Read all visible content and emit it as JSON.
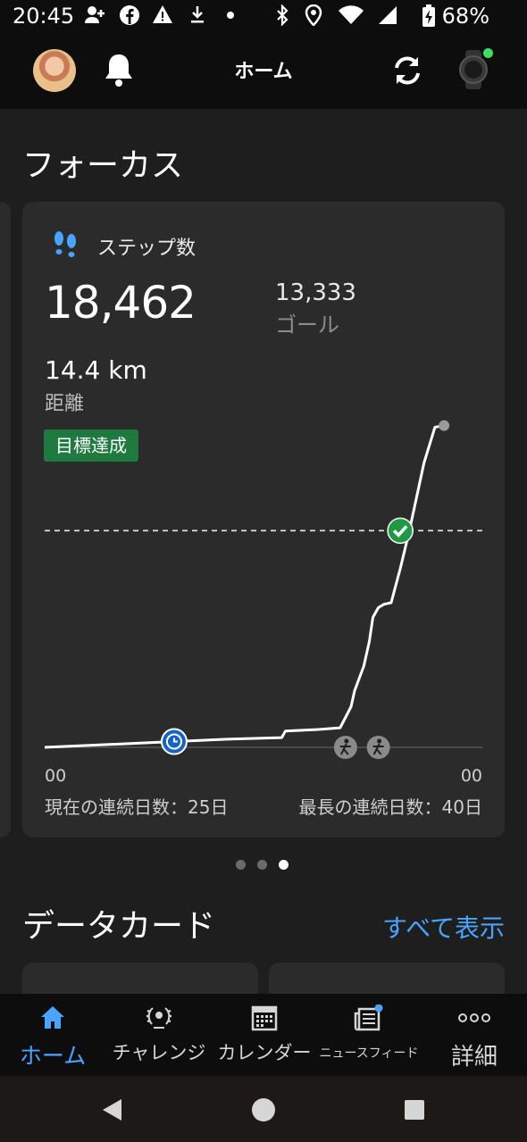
{
  "status_bar": {
    "time": "20:45",
    "battery": "68%",
    "icons": [
      "add-person-icon",
      "facebook-icon",
      "warning-icon",
      "download-icon",
      "dot-icon",
      "bluetooth-icon",
      "location-icon",
      "wifi-icon",
      "signal-icon",
      "battery-charging-icon"
    ]
  },
  "app_bar": {
    "title": "ホーム"
  },
  "focus": {
    "title": "フォーカス",
    "card": {
      "label": "ステップ数",
      "steps": "18,462",
      "goal_value": "13,333",
      "goal_label": "ゴール",
      "distance": "14.4 km",
      "distance_label": "距離",
      "badge": "目標達成",
      "axis_start": "00",
      "axis_end": "00",
      "current_streak": "現在の連続日数：25日",
      "longest_streak": "最長の連続日数：40日"
    },
    "pager": {
      "count": 3,
      "active": 3
    }
  },
  "chart_data": {
    "type": "line",
    "title": "",
    "xlabel": "",
    "ylabel": "",
    "x_unit": "hour",
    "xlim": [
      0,
      24
    ],
    "ylim": [
      0,
      20000
    ],
    "goal_line": 13333,
    "x_ticks": [
      "00",
      "00"
    ],
    "series": [
      {
        "name": "",
        "x": [
          0,
          3,
          6,
          7,
          10,
          13,
          13.2,
          15,
          16.2,
          16.8,
          17,
          17.5,
          17.8,
          18,
          18.3,
          18.6,
          19,
          19.5,
          20,
          20.8,
          21.4,
          21.9
        ],
        "y": [
          0,
          150,
          300,
          350,
          500,
          600,
          1000,
          1100,
          1200,
          2500,
          3500,
          5000,
          6500,
          8000,
          8600,
          8800,
          8900,
          11000,
          13333,
          17500,
          19700,
          19800
        ]
      }
    ],
    "markers": [
      {
        "type": "sleep-icon",
        "x": 7.1
      },
      {
        "type": "goal-check-icon",
        "x": 19.5
      },
      {
        "type": "activity-walk-icon",
        "x": 16.5
      },
      {
        "type": "activity-walk-icon",
        "x": 18.3
      }
    ]
  },
  "data_cards": {
    "title": "データカード",
    "view_all": "すべて表示"
  },
  "bottom_nav": {
    "items": [
      {
        "label": "ホーム",
        "icon": "home-icon",
        "active": true
      },
      {
        "label": "チャレンジ",
        "icon": "laurel-icon",
        "active": false
      },
      {
        "label": "カレンダー",
        "icon": "calendar-icon",
        "active": false
      },
      {
        "label": "ニュースフィード",
        "icon": "newsfeed-icon",
        "active": false
      },
      {
        "label": "詳細",
        "icon": "more-icon",
        "active": false
      }
    ]
  },
  "colors": {
    "accent": "#4aa3ff",
    "goal_green": "#1e9a46",
    "badge": "#1e7a3e",
    "card": "#2b2b2b"
  }
}
